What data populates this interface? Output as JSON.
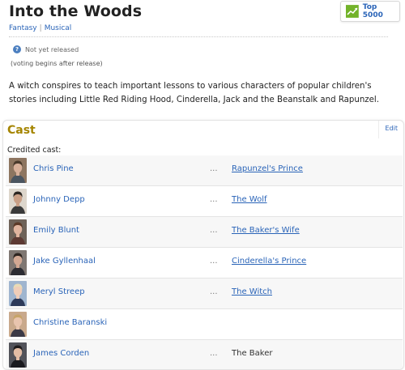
{
  "title": "Into the Woods",
  "genres": [
    "Fantasy",
    "Musical"
  ],
  "badge": {
    "label": "Top 5000"
  },
  "status": {
    "text": "Not yet released",
    "voting": "(voting begins after release)"
  },
  "description": "A witch conspires to teach important lessons to various characters of popular children's stories including Little Red Riding Hood, Cinderella, Jack and the Beanstalk and Rapunzel.",
  "cast": {
    "heading": "Cast",
    "edit": "Edit",
    "credited_label": "Credited cast:",
    "separator": "...",
    "members": [
      {
        "actor": "Chris Pine",
        "character": "Rapunzel's Prince",
        "character_link": true,
        "avatar": {
          "bg": "#8d7560",
          "hair": "#4a3a2c",
          "skin": "#d8b09a",
          "shirt": "#4b5560"
        }
      },
      {
        "actor": "Johnny Depp",
        "character": "The Wolf",
        "character_link": true,
        "avatar": {
          "bg": "#ddd6cc",
          "hair": "#2b2622",
          "skin": "#c99f86",
          "shirt": "#3a3a3a"
        }
      },
      {
        "actor": "Emily Blunt",
        "character": "The Baker's Wife",
        "character_link": true,
        "avatar": {
          "bg": "#6e6258",
          "hair": "#5c3a28",
          "skin": "#e0b49e",
          "shirt": "#5d3a33"
        }
      },
      {
        "actor": "Jake Gyllenhaal",
        "character": "Cinderella's Prince",
        "character_link": true,
        "avatar": {
          "bg": "#7f7772",
          "hair": "#2e2520",
          "skin": "#d2a893",
          "shirt": "#2c2c32"
        }
      },
      {
        "actor": "Meryl Streep",
        "character": "The Witch",
        "character_link": true,
        "avatar": {
          "bg": "#9fb5cf",
          "hair": "#e8dbb7",
          "skin": "#efcdb8",
          "shirt": "#2d3a5a"
        }
      },
      {
        "actor": "Christine Baranski",
        "character": "",
        "character_link": false,
        "avatar": {
          "bg": "#c9a98c",
          "hair": "#c7a469",
          "skin": "#e8c4ae",
          "shirt": "#3c3a46"
        }
      },
      {
        "actor": "James Corden",
        "character": "The Baker",
        "character_link": false,
        "avatar": {
          "bg": "#52535a",
          "hair": "#1f1c1c",
          "skin": "#e2bca4",
          "shirt": "#1a1a1f"
        }
      }
    ]
  },
  "colors": {
    "link": "#2a64b8",
    "cast_heading": "#a58500",
    "top5000_green": "#73b32a"
  },
  "icons": {
    "badge": "trend-chart-icon",
    "status": "question-icon"
  }
}
